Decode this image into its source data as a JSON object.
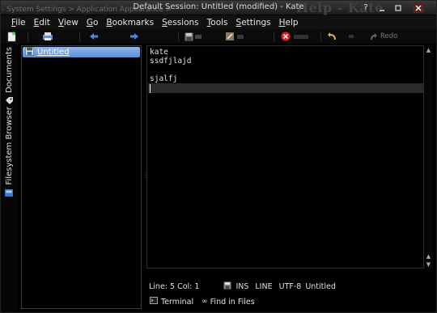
{
  "window": {
    "title": "Default Session: Untitled (modified) - Kate",
    "ghost_left": "- System Settings > Application Appearance >",
    "ghost_right": "Help - Kate"
  },
  "menu": [
    {
      "label": "File"
    },
    {
      "label": "Edit"
    },
    {
      "label": "View"
    },
    {
      "label": "Go"
    },
    {
      "label": "Bookmarks"
    },
    {
      "label": "Sessions"
    },
    {
      "label": "Tools"
    },
    {
      "label": "Settings"
    },
    {
      "label": "Help"
    }
  ],
  "toolbar": {
    "redo_label": "Redo"
  },
  "sidebar": {
    "tabs": [
      {
        "label": "Documents",
        "icon": "documents-icon"
      },
      {
        "label": "Filesystem Browser",
        "icon": "filesystem-icon"
      }
    ]
  },
  "documents": [
    {
      "name": "Untitled",
      "selected": true
    }
  ],
  "editor": {
    "lines": [
      "kate",
      "ssdfjlajd",
      "",
      "sjalfj",
      ""
    ],
    "current_line": 5
  },
  "status": {
    "position": "Line: 5 Col: 1",
    "mode": "INS",
    "selection": "LINE",
    "encoding": "UTF-8",
    "doc_name": "Untitled"
  },
  "toolviews": {
    "terminal": "Terminal",
    "find": "Find in Files"
  },
  "colors": {
    "selection": "#6f9be0",
    "background": "#000000"
  }
}
